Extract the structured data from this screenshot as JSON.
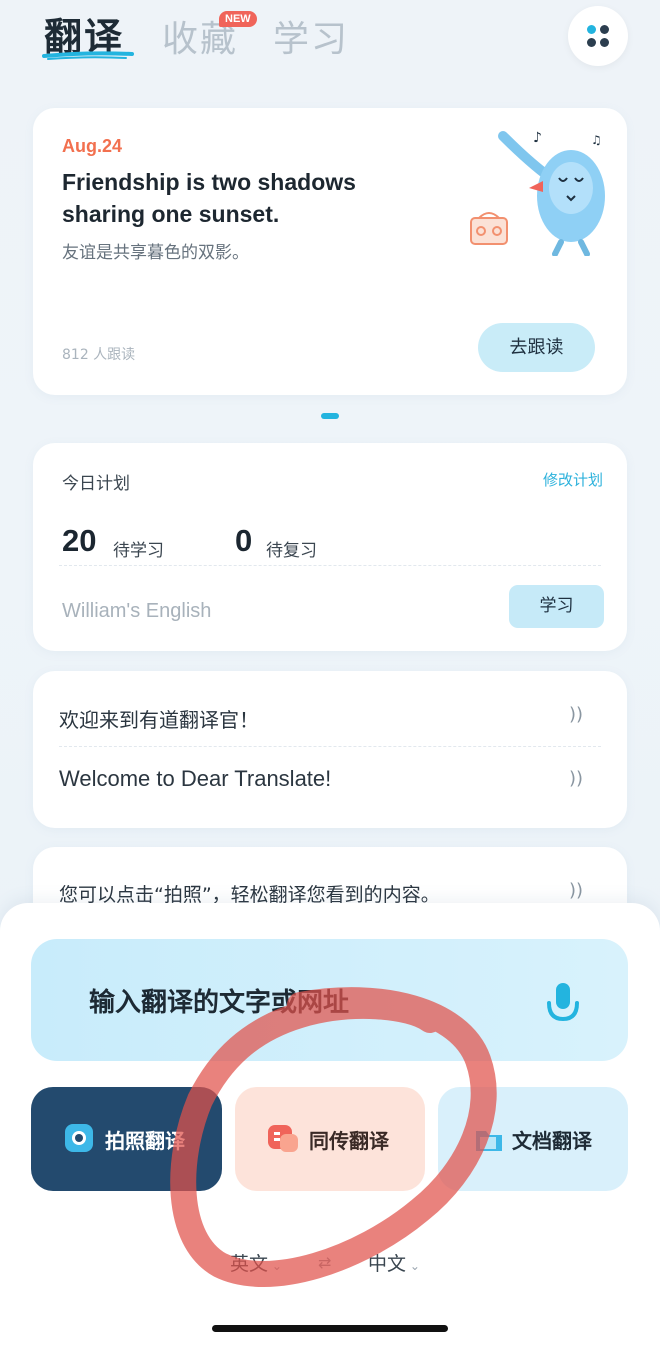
{
  "header": {
    "tabs": [
      {
        "label": "翻译",
        "active": true
      },
      {
        "label": "收藏",
        "badge": "NEW"
      },
      {
        "label": "学习"
      }
    ],
    "menu_icon": "grid-dots-icon"
  },
  "daily": {
    "date": "Aug.24",
    "sentence_en": "Friendship is two shadows sharing one sunset.",
    "sentence_zh": "友谊是共享暮色的双影。",
    "followers": "812 人跟读",
    "follow_button": "去跟读"
  },
  "plan": {
    "title": "今日计划",
    "edit": "修改计划",
    "to_learn_count": "20",
    "to_learn_label": "待学习",
    "to_review_count": "0",
    "to_review_label": "待复习",
    "book": "William's English",
    "study_button": "学习"
  },
  "welcome": {
    "line_zh": "欢迎来到有道翻译官！",
    "line_en": "Welcome to Dear Translate!"
  },
  "tip": {
    "text": "您可以点击“拍照”，轻松翻译您看到的内容。"
  },
  "translate": {
    "placeholder": "输入翻译的文字或网址",
    "features": [
      {
        "label": "拍照翻译",
        "icon": "camera-icon"
      },
      {
        "label": "同传翻译",
        "icon": "simultaneous-translation-icon"
      },
      {
        "label": "文档翻译",
        "icon": "document-icon"
      }
    ],
    "source_lang": "英文",
    "target_lang": "中文",
    "swap_symbol": "⇄"
  },
  "colors": {
    "accent": "#23b4df",
    "date": "#f2704f",
    "photo_btn": "#234a6e",
    "sim_btn": "#fde3da",
    "annotation": "#e0524b"
  }
}
